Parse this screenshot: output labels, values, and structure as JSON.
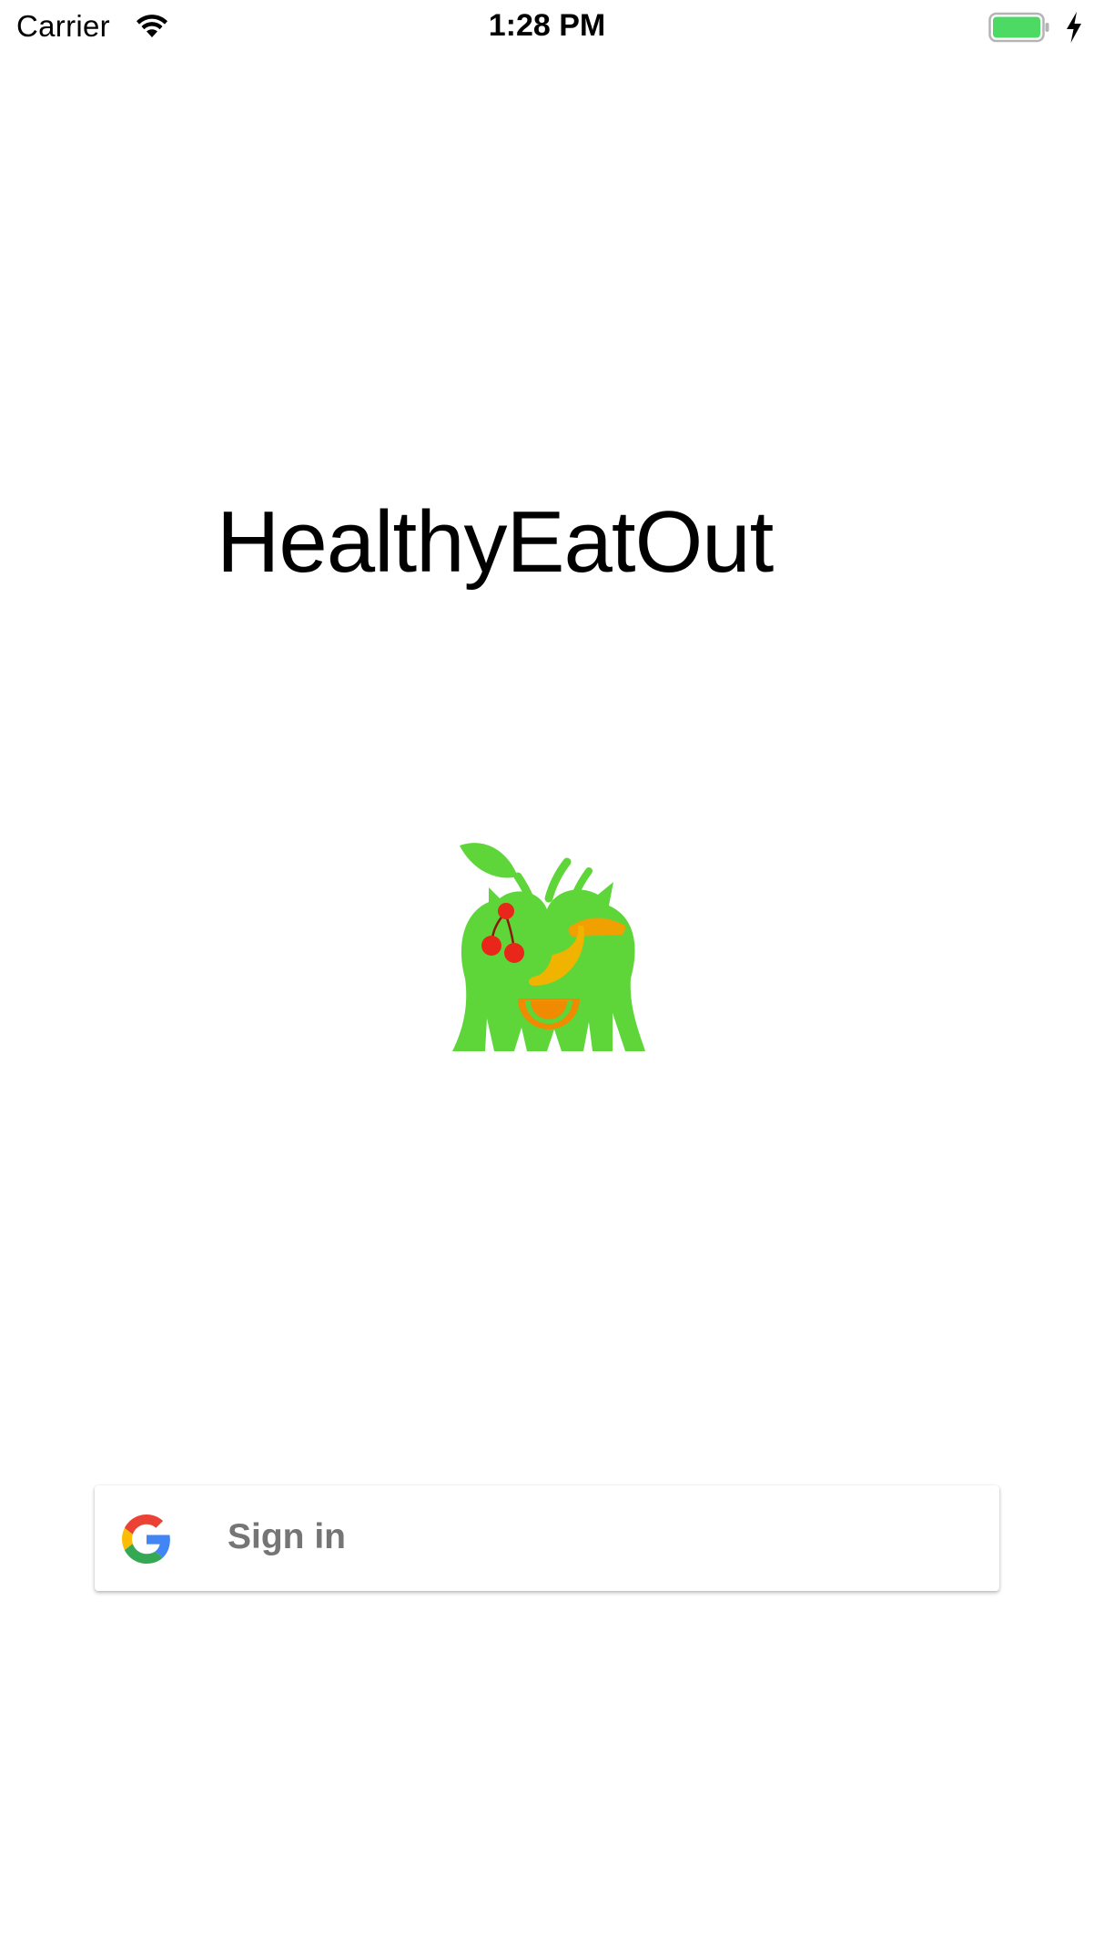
{
  "status_bar": {
    "carrier": "Carrier",
    "time": "1:28 PM",
    "wifi_icon": "wifi-icon",
    "battery_icon": "battery-icon",
    "charging_icon": "charging-bolt-icon",
    "battery_color": "#4cd964"
  },
  "main": {
    "title": "HealthyEatOut",
    "logo_icon": "fruit-apple-logo",
    "logo_color": "#5ed63a"
  },
  "signin": {
    "label": "Sign in",
    "icon": "google-icon"
  }
}
